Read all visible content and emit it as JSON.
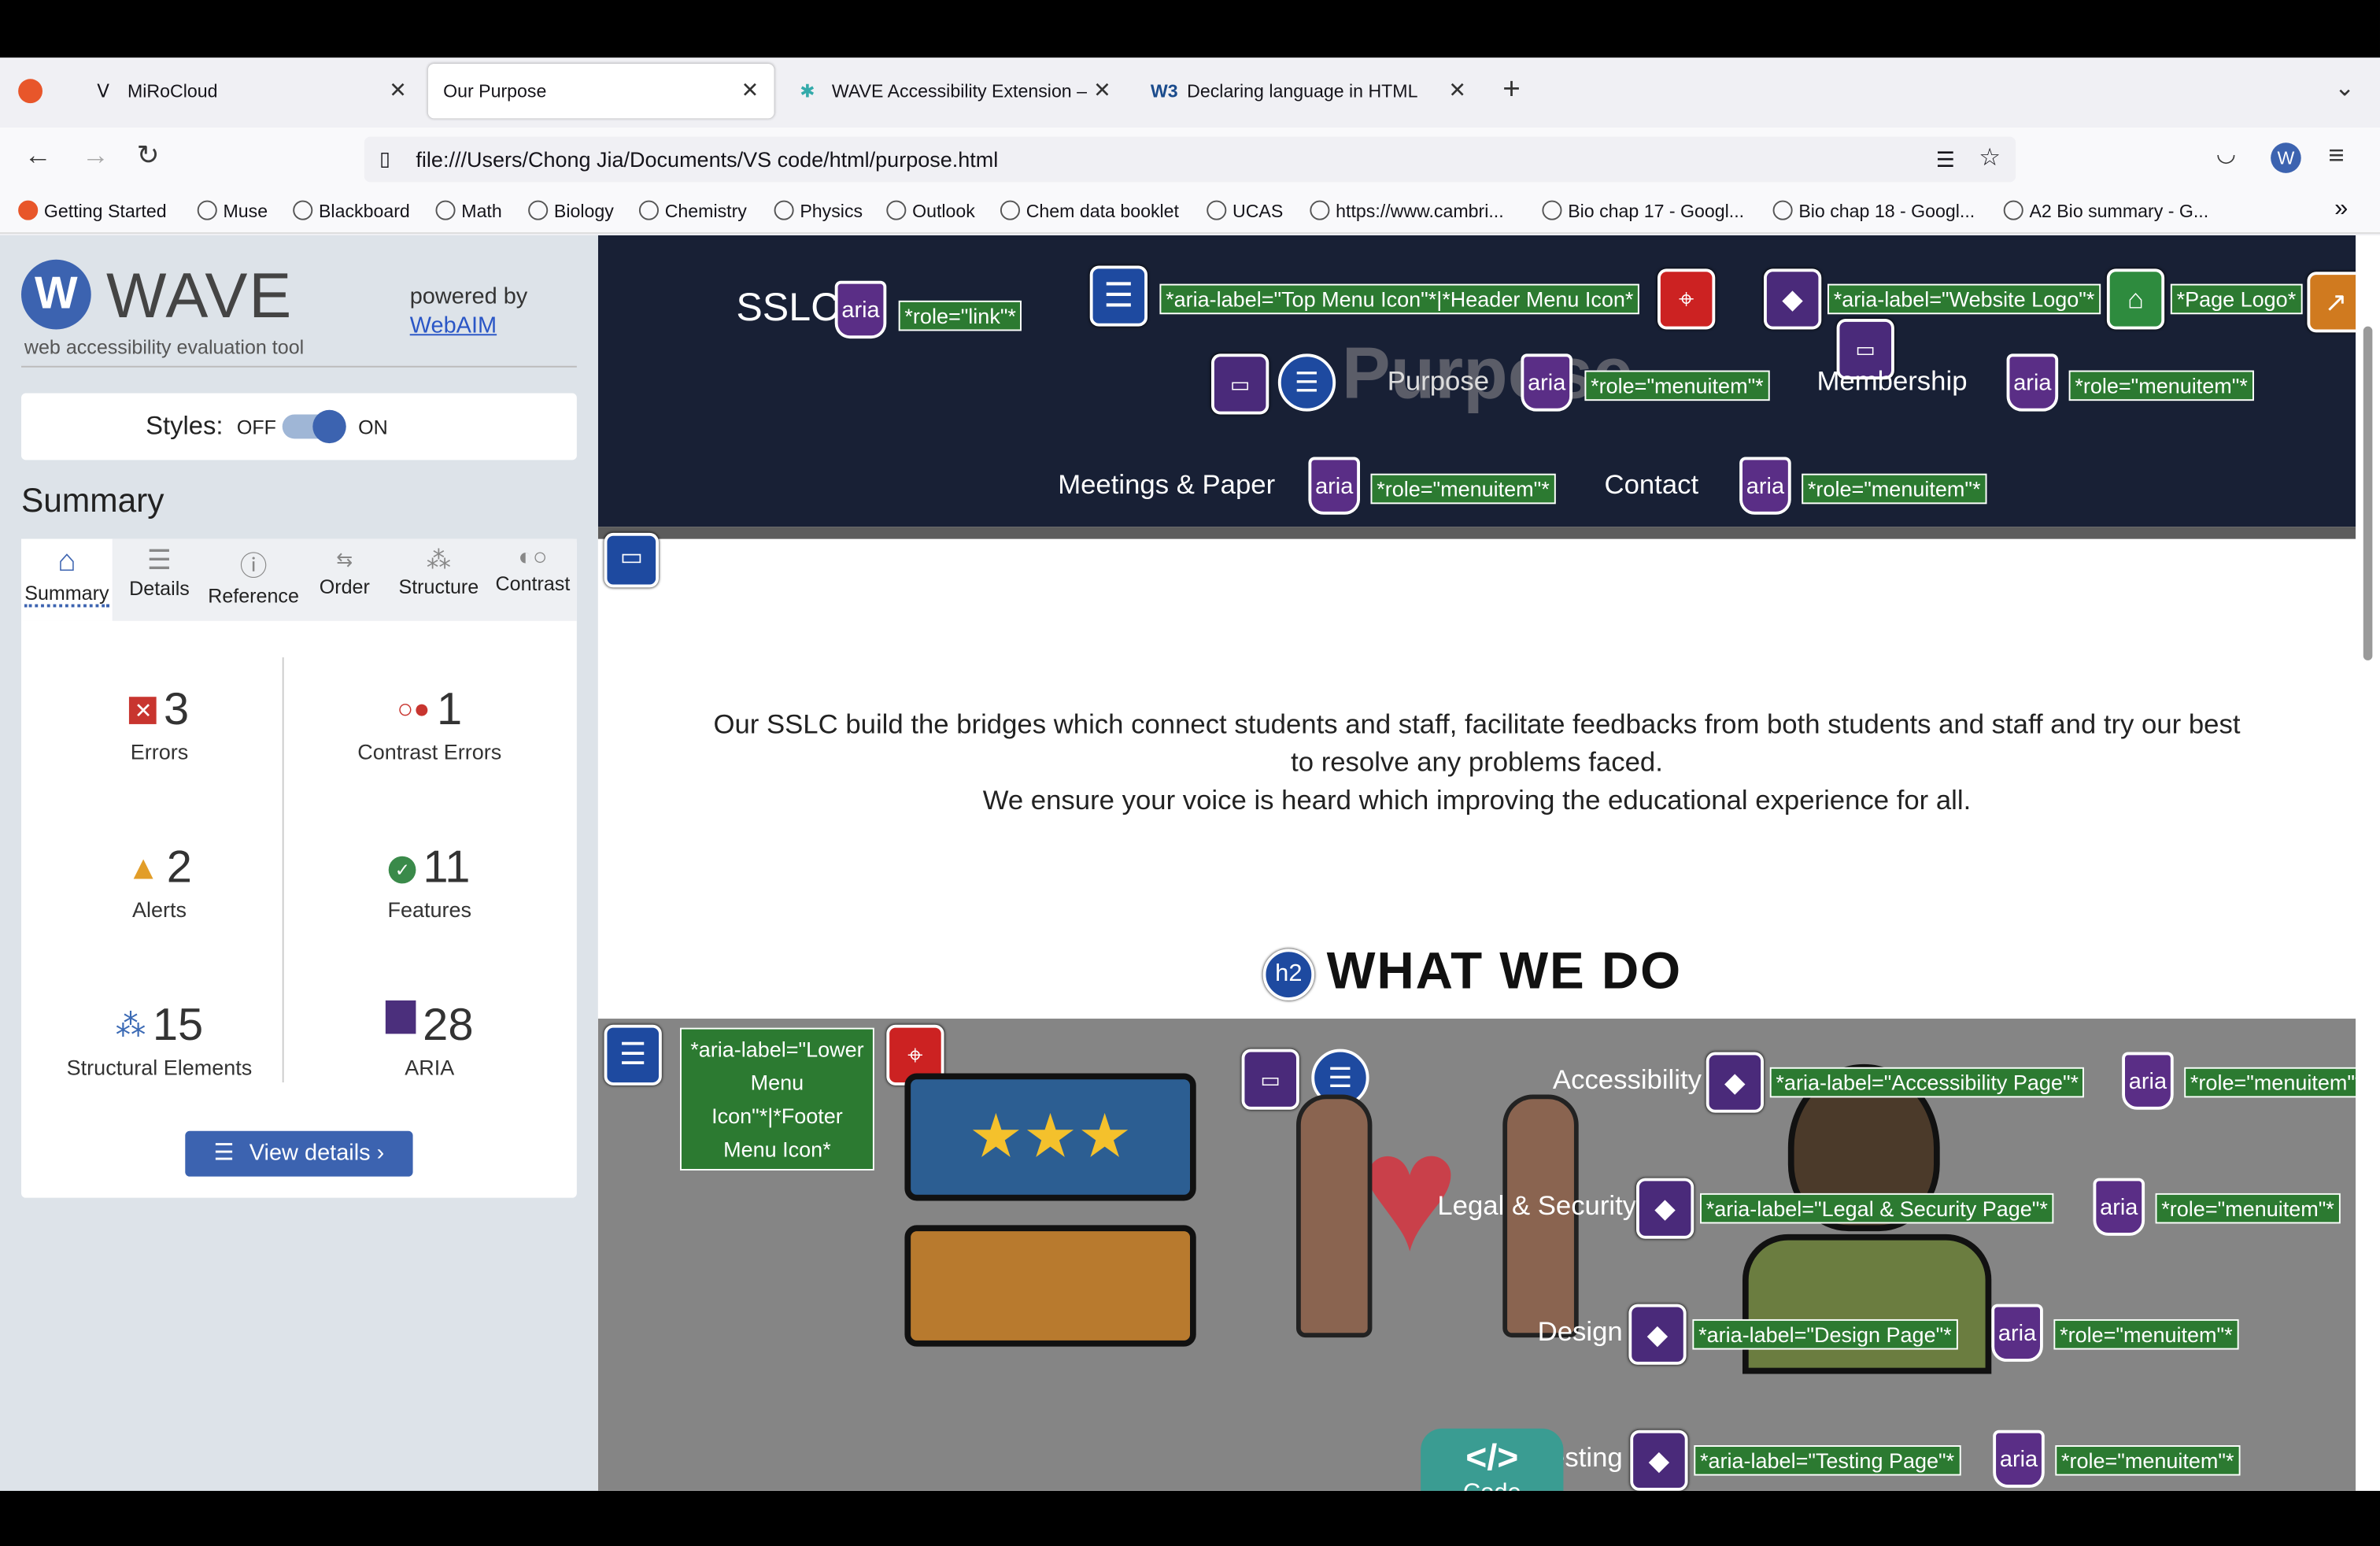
{
  "browser": {
    "tabs": [
      {
        "title": "MiRoCloud"
      },
      {
        "title": "Our Purpose"
      },
      {
        "title": "WAVE Accessibility Extension –"
      },
      {
        "title": "Declaring language in HTML"
      }
    ],
    "url": "file:///Users/Chong Jia/Documents/VS code/html/purpose.html",
    "bookmarks": [
      "Getting Started",
      "Muse",
      "Blackboard",
      "Math",
      "Biology",
      "Chemistry",
      "Physics",
      "Outlook",
      "Chem data booklet",
      "UCAS",
      "https://www.cambri...",
      "Bio chap 17 - Googl...",
      "Bio chap 18 - Googl...",
      "A2 Bio summary - G..."
    ]
  },
  "wave": {
    "logo": "WAVE",
    "tagline": "web accessibility evaluation tool",
    "powered_by": "powered by",
    "webaim": "WebAIM",
    "styles_label": "Styles:",
    "off": "OFF",
    "on": "ON",
    "summary_title": "Summary",
    "tabs": [
      "Summary",
      "Details",
      "Reference",
      "Order",
      "Structure",
      "Contrast"
    ],
    "stats": [
      {
        "value": "3",
        "label": "Errors"
      },
      {
        "value": "1",
        "label": "Contrast Errors"
      },
      {
        "value": "2",
        "label": "Alerts"
      },
      {
        "value": "11",
        "label": "Features"
      },
      {
        "value": "15",
        "label": "Structural Elements"
      },
      {
        "value": "28",
        "label": "ARIA"
      }
    ],
    "view_details": "View details ›",
    "colors": {
      "error": "#c8352f",
      "alert": "#e29d28",
      "feature": "#3a8a4a",
      "structure": "#3b6ab5",
      "aria": "#4b2f7c",
      "button": "#3c63b0"
    }
  },
  "page": {
    "brand": "SSLC",
    "role_link": "*role=\"link\"*",
    "aria": "aria",
    "top_menu_icon": "*aria-label=\"Top Menu Icon\"*|*Header Menu Icon*",
    "website_logo": "*aria-label=\"Website Logo\"*",
    "page_logo": "*Page Logo*",
    "role_menuitem": "*role=\"menuitem\"*",
    "nav": [
      "Purpose",
      "Membership",
      "Meetings & Paper",
      "Contact"
    ],
    "purpose_watermark": "Purpose",
    "intro": "Our SSLC build the bridges which connect students and staff, facilitate feedbacks from both students and staff and try our best to resolve any problems faced.",
    "intro2": "We ensure your voice is heard which improving the educational experience for all.",
    "h2_badge": "h2",
    "h2": "WHAT WE DO",
    "lower_label": "*aria-label=\"Lower Menu Icon\"*|*Footer Menu Icon*",
    "footer_items": [
      {
        "name": "Accessibility",
        "label": "*aria-label=\"Accessibility Page\"*"
      },
      {
        "name": "Legal & Security",
        "label": "*aria-label=\"Legal & Security Page\"*"
      },
      {
        "name": "Design",
        "label": "*aria-label=\"Design Page\"*"
      },
      {
        "name": "Testing",
        "label": "*aria-label=\"Testing Page\"*"
      }
    ],
    "code_btn_icon": "</>",
    "code_btn": "Code"
  }
}
